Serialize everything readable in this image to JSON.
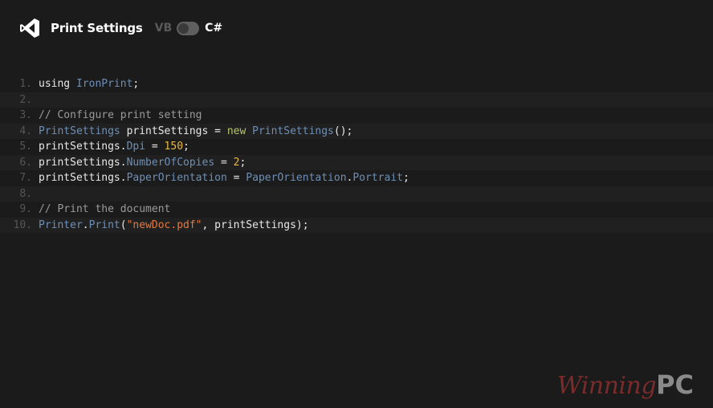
{
  "header": {
    "title": "Print Settings",
    "lang_vb": "VB",
    "lang_cs": "C#",
    "logo_icon": "visual-studio-icon"
  },
  "code": {
    "lines": [
      {
        "num": "1.",
        "tokens": [
          {
            "t": "using ",
            "c": "id"
          },
          {
            "t": "IronPrint",
            "c": "type"
          },
          {
            "t": ";",
            "c": "id"
          }
        ]
      },
      {
        "num": "2.",
        "tokens": []
      },
      {
        "num": "3.",
        "tokens": [
          {
            "t": "// Configure print setting",
            "c": "com"
          }
        ]
      },
      {
        "num": "4.",
        "tokens": [
          {
            "t": "PrintSettings",
            "c": "type"
          },
          {
            "t": " printSettings = ",
            "c": "id"
          },
          {
            "t": "new",
            "c": "kw"
          },
          {
            "t": " ",
            "c": "id"
          },
          {
            "t": "PrintSettings",
            "c": "type"
          },
          {
            "t": "();",
            "c": "id"
          }
        ]
      },
      {
        "num": "5.",
        "tokens": [
          {
            "t": "printSettings.",
            "c": "id"
          },
          {
            "t": "Dpi",
            "c": "type"
          },
          {
            "t": " = ",
            "c": "id"
          },
          {
            "t": "150",
            "c": "num"
          },
          {
            "t": ";",
            "c": "id"
          }
        ]
      },
      {
        "num": "6.",
        "tokens": [
          {
            "t": "printSettings.",
            "c": "id"
          },
          {
            "t": "NumberOfCopies",
            "c": "type"
          },
          {
            "t": " = ",
            "c": "id"
          },
          {
            "t": "2",
            "c": "num"
          },
          {
            "t": ";",
            "c": "id"
          }
        ]
      },
      {
        "num": "7.",
        "tokens": [
          {
            "t": "printSettings.",
            "c": "id"
          },
          {
            "t": "PaperOrientation",
            "c": "type"
          },
          {
            "t": " = ",
            "c": "id"
          },
          {
            "t": "PaperOrientation",
            "c": "type"
          },
          {
            "t": ".",
            "c": "id"
          },
          {
            "t": "Portrait",
            "c": "type"
          },
          {
            "t": ";",
            "c": "id"
          }
        ]
      },
      {
        "num": "8.",
        "tokens": []
      },
      {
        "num": "9.",
        "tokens": [
          {
            "t": "// Print the document",
            "c": "com"
          }
        ]
      },
      {
        "num": "10.",
        "tokens": [
          {
            "t": "Printer",
            "c": "type"
          },
          {
            "t": ".",
            "c": "id"
          },
          {
            "t": "Print",
            "c": "type"
          },
          {
            "t": "(",
            "c": "id"
          },
          {
            "t": "\"newDoc.pdf\"",
            "c": "str"
          },
          {
            "t": ", printSettings);",
            "c": "id"
          }
        ]
      }
    ]
  },
  "watermark": {
    "part_a": "Winning",
    "part_b": "PC"
  },
  "colors": {
    "background": "#1b1b1b",
    "type": "#6e8fb5",
    "keyword": "#b7c56e",
    "number": "#e8b84a",
    "string": "#e07a45",
    "comment": "#9a9a9a"
  }
}
